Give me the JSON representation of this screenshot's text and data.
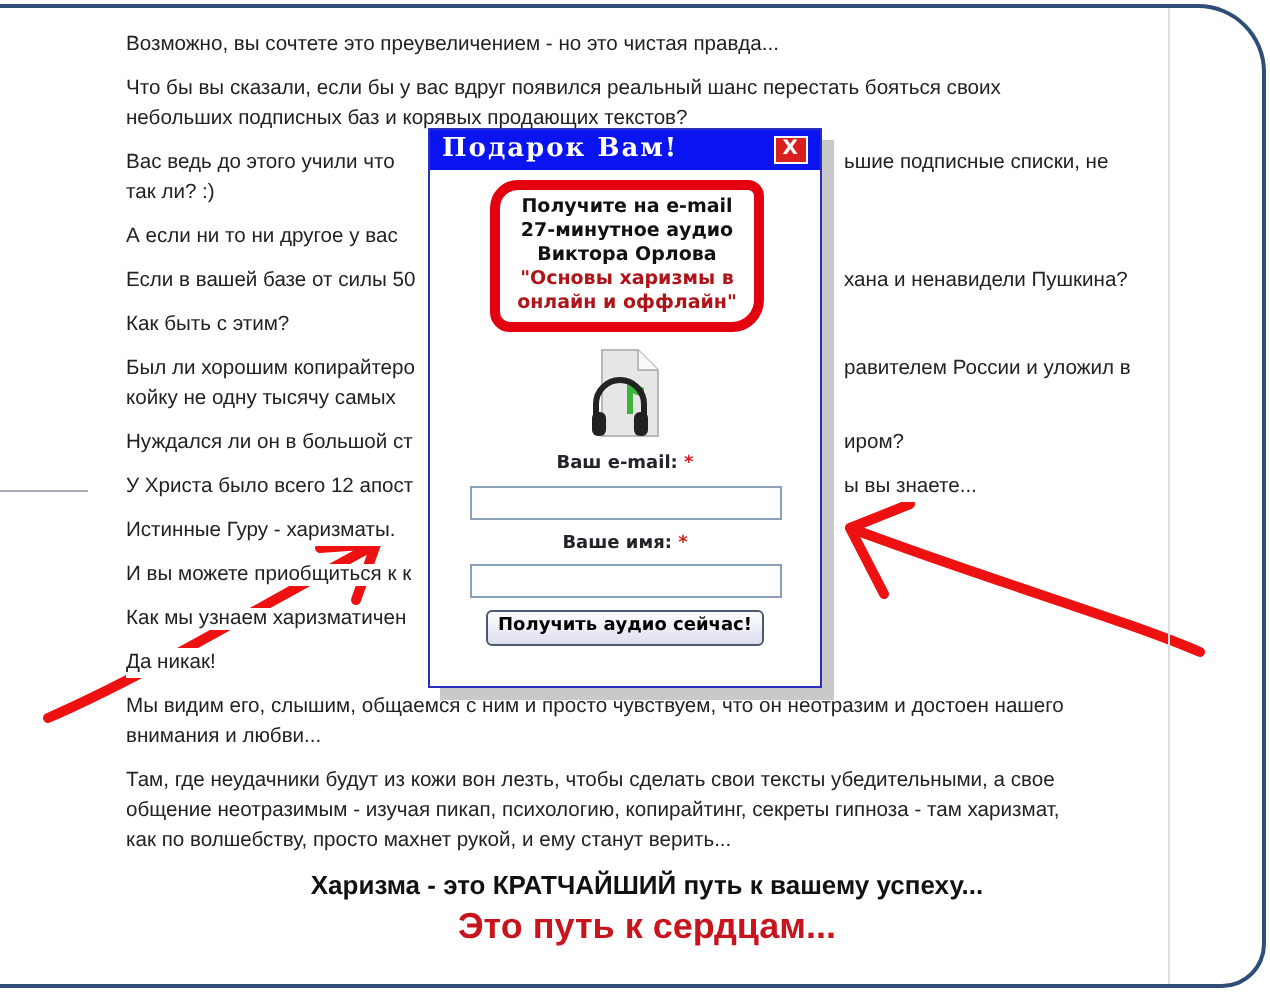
{
  "article": {
    "paragraphs": [
      {
        "lines": [
          {
            "kind": "full",
            "text": "Возможно, вы сочтете это преувеличением - но это чистая правда..."
          }
        ]
      },
      {
        "lines": [
          {
            "kind": "full",
            "text": "Что бы вы сказали, если бы у вас вдруг появился реальный шанс перестать бояться своих"
          },
          {
            "kind": "full",
            "text": "небольших подписных баз и корявых продающих текстов?"
          }
        ]
      },
      {
        "lines": [
          {
            "kind": "split",
            "left": "Вас ведь до этого учили что",
            "right": "ьшие подписные списки, не"
          },
          {
            "kind": "full",
            "text": "так ли? :)"
          }
        ]
      },
      {
        "lines": [
          {
            "kind": "split",
            "left": "А если ни то ни другое у вас"
          }
        ]
      },
      {
        "lines": [
          {
            "kind": "split",
            "left": "Если в вашей базе от силы 50",
            "right": "хана и ненавидели Пушкина?"
          }
        ]
      },
      {
        "lines": [
          {
            "kind": "full",
            "text": "Как быть с этим?"
          }
        ]
      },
      {
        "lines": [
          {
            "kind": "split",
            "left": "Был ли хорошим копирайтеро",
            "right": "равителем России и уложил в"
          },
          {
            "kind": "split",
            "left": "койку не одну тысячу самых"
          }
        ]
      },
      {
        "lines": [
          {
            "kind": "split",
            "left": "Нуждался ли он в большой ст",
            "right": "иром?"
          }
        ]
      },
      {
        "lines": [
          {
            "kind": "split",
            "left": "У Христа было всего 12 апост",
            "right": "ы вы знаете..."
          }
        ]
      },
      {
        "lines": [
          {
            "kind": "full",
            "text": "Истинные Гуру - харизматы."
          }
        ]
      },
      {
        "lines": [
          {
            "kind": "split",
            "left": "И вы можете приобщиться к к"
          }
        ]
      },
      {
        "lines": [
          {
            "kind": "split",
            "left": "Как мы узнаем харизматичен"
          }
        ]
      },
      {
        "lines": [
          {
            "kind": "full",
            "text": "Да никак!"
          }
        ]
      },
      {
        "lines": [
          {
            "kind": "full",
            "text": "Мы видим его, слышим, общаемся с ним и просто чувствуем, что он неотразим и достоен нашего"
          },
          {
            "kind": "full",
            "text": "внимания и любви..."
          }
        ]
      },
      {
        "lines": [
          {
            "kind": "full",
            "text": "Там, где неудачники будут из кожи вон лезть, чтобы сделать свои тексты убедительными, а свое"
          },
          {
            "kind": "full",
            "text": "общение неотразимым - изучая пикап, психологию, копирайтинг, секреты гипноза - там харизмат,"
          },
          {
            "kind": "full",
            "text": "как по волшебству, просто махнет рукой, и ему станут верить..."
          }
        ]
      }
    ],
    "headline": "Харизма - это КРАТЧАЙШИЙ путь к вашему успеху...",
    "tagline": "Это путь к сердцам..."
  },
  "popup": {
    "title": "Подарок Вам!",
    "close": "X",
    "offer": {
      "lines": [
        "Получите на e-mail",
        "27-минутное аудио",
        "Виктора Орлова"
      ],
      "highlight": [
        "\"Основы харизмы в",
        "онлайн и оффлайн\""
      ]
    },
    "fields": [
      {
        "label": "Ваш e-mail:",
        "required": true,
        "required_mark": "*"
      },
      {
        "label": "Ваше имя:",
        "required": true,
        "required_mark": "*"
      }
    ],
    "button": "Получить аудио сейчас!"
  }
}
